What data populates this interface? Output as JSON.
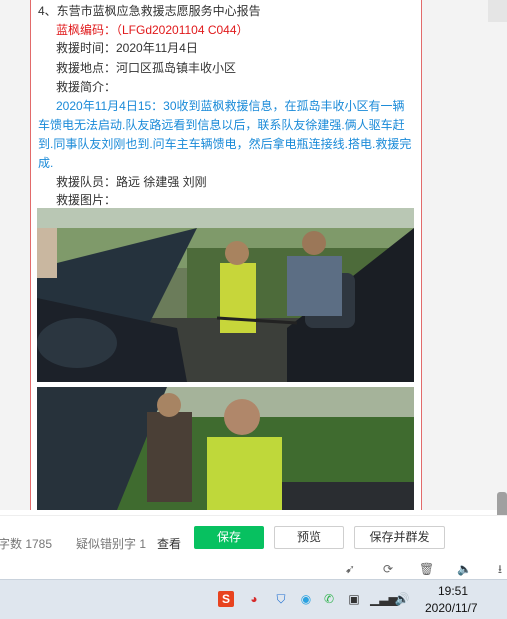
{
  "report": {
    "heading": "4、东营市蓝枫应急救援志愿服务中心报告",
    "code_line": "蓝枫编码：（LFGd20201104  C044）",
    "time_line": "救援时间：2020年11月4日",
    "place_line": "救援地点：河口区孤岛镇丰收小区",
    "intro_label": "救援简介：",
    "intro_lines": [
      "2020年11月4日15：30收到蓝枫救援信息，在孤岛丰收小区有一辆",
      "车馈电无法启动.队友路远看到信息以后，联系队友徐建强.俩人驱车赶",
      "到.同事队友刘刚也到.问车主车辆馈电，然后拿电瓶连接线.搭电.救援完",
      "成."
    ],
    "members_line": "救援队员：路远 徐建强 刘刚",
    "photos_label": "救援图片："
  },
  "actionbar": {
    "word_count": "字数 1785",
    "typo_label": "疑似错别字 1",
    "typo_link": "查看",
    "save_label": "保存",
    "preview_label": "预览",
    "save_publish_label": "保存并群发"
  },
  "taskbar": {
    "time": "19:51",
    "date": "2020/11/7"
  },
  "colors": {
    "red_text": "#e0191b",
    "blue_text": "#1a8ad8",
    "primary_green": "#07c160",
    "doc_border": "#e26a6a"
  }
}
